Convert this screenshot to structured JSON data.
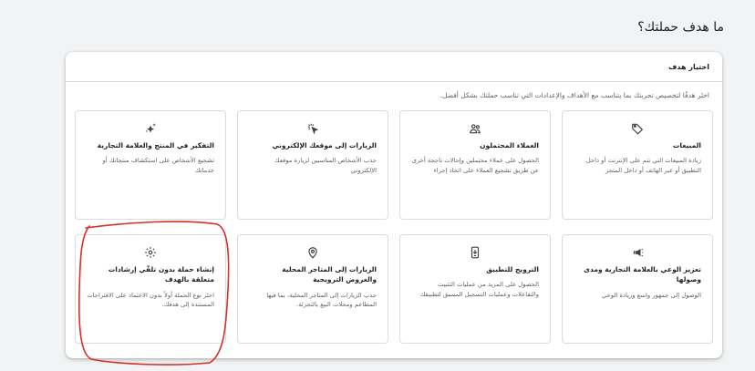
{
  "page": {
    "heading": "ما هدف حملتك؟"
  },
  "panel": {
    "title": "اختيار هدف",
    "description": "اختَر هدفًا لتخصيص تجربتك بما يتناسب مع الأهداف والإعدادات التي تناسب حملتك بشكل أفضل."
  },
  "cards": [
    {
      "icon": "tag-icon",
      "title": "المبيعات",
      "desc": "زيادة المبيعات التي تتم على الإنترنت أو داخل التطبيق أو عبر الهاتف أو داخل المتجر"
    },
    {
      "icon": "people-icon",
      "title": "العملاء المحتملون",
      "desc": "الحصول على عملاء محتملين وإحالات ناجحة أخرى عن طريق تشجيع العملاء على اتخاذ إجراء"
    },
    {
      "icon": "cursor-click-icon",
      "title": "الزيارات إلى موقعك الإلكتروني",
      "desc": "جذب الأشخاص المناسبين لزيارة موقعك الإلكتروني"
    },
    {
      "icon": "sparkle-icon",
      "title": "التفكير في المنتج والعلامة التجارية",
      "desc": "تشجيع الأشخاص على استكشاف منتجاتك أو خدماتك"
    },
    {
      "icon": "megaphone-icon",
      "title": "تعزيز الوعي بالعلامة التجارية ومدى وصولها",
      "desc": "الوصول إلى جمهور واسع وزيادة الوعي"
    },
    {
      "icon": "phone-app-icon",
      "title": "الترويج للتطبيق",
      "desc": "الحصول على المزيد من عمليات التثبيت والتفاعلات وعمليات التسجيل المسبق لتطبيقك"
    },
    {
      "icon": "location-pin-icon",
      "title": "الزيارات إلى المتاجر المحلية والعروض الترويجية",
      "desc": "جذب الزيارات إلى المتاجر المحلية، بما فيها المطاعم ومحلات البيع بالتجزئة."
    },
    {
      "icon": "gear-icon",
      "title": "إنشاء حملة بدون تلقّي إرشادات متعلقة بالهدف",
      "desc": "اختَر نوع الحملة أولاً بدون الاعتماد على الاقتراحات المستندة إلى هدفك."
    }
  ],
  "colors": {
    "annotation": "#d93025",
    "icon": "#3c4043"
  }
}
